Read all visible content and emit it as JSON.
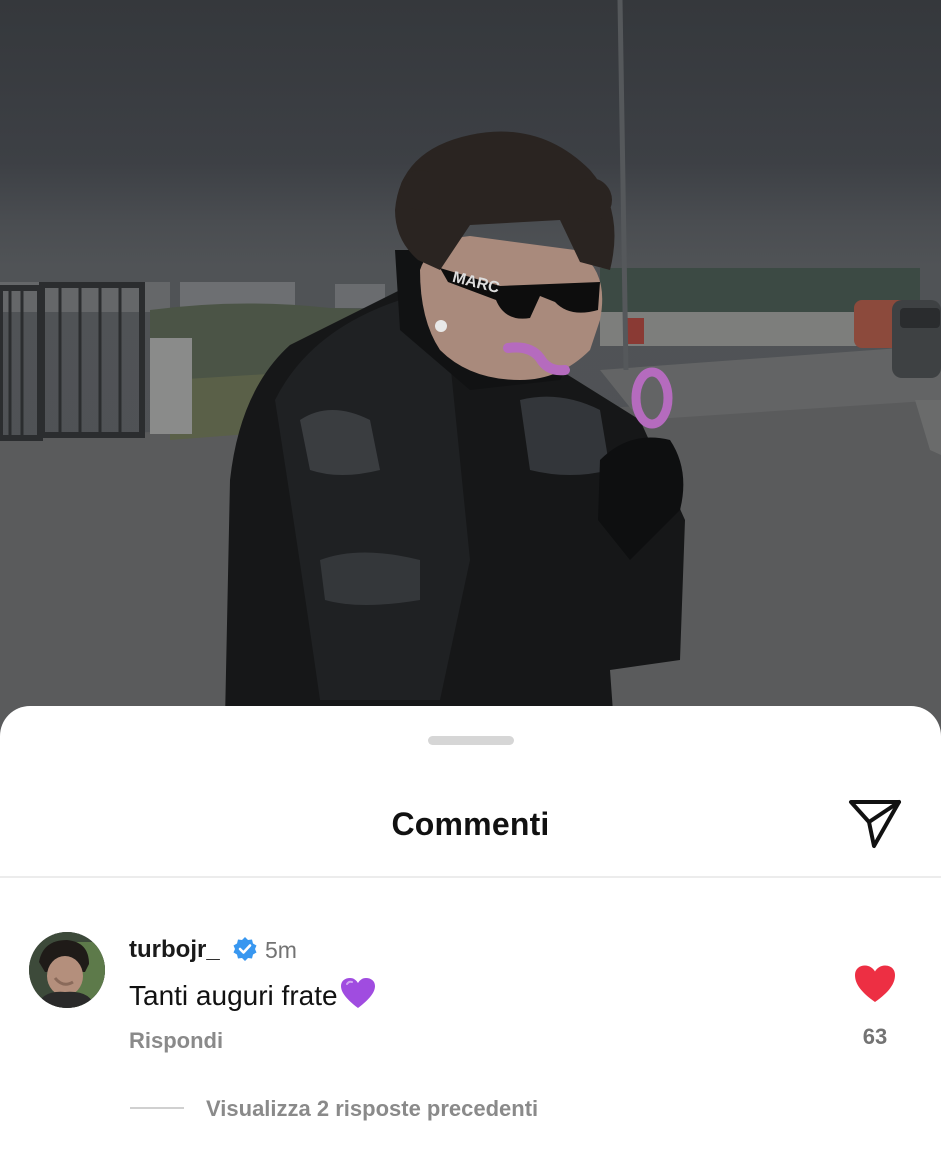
{
  "post_photo": {
    "glasses_text": "MARC"
  },
  "comments_sheet": {
    "title": "Commenti",
    "share_icon": "paper-plane-icon"
  },
  "comment": {
    "username": "turbojr_",
    "verified_icon": "verified-badge-icon",
    "time": "5m",
    "text": "Tanti auguri frate",
    "emoji": "purple-heart-emoji",
    "reply_label": "Rispondi",
    "like_icon": "heart-icon",
    "like_count": "63",
    "like_color": "#ed2f43",
    "view_replies_label": "Visualizza 2 risposte precedenti"
  },
  "colors": {
    "verified_blue": "#3897f0",
    "emoji_purple": "#a04ce0"
  }
}
